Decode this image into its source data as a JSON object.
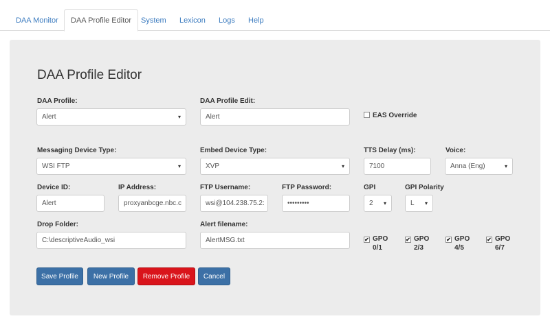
{
  "tabs": [
    "DAA Monitor",
    "DAA Profile Editor",
    "System",
    "Lexicon",
    "Logs",
    "Help"
  ],
  "active_tab": "DAA Profile Editor",
  "page_title": "DAA Profile Editor",
  "form": {
    "daa_profile": {
      "label": "DAA Profile:",
      "value": "Alert"
    },
    "daa_profile_edit": {
      "label": "DAA Profile Edit:",
      "value": "Alert"
    },
    "eas_override": {
      "label": "EAS Override",
      "checked": false
    },
    "messaging_device_type": {
      "label": "Messaging Device Type:",
      "value": "WSI FTP"
    },
    "embed_device_type": {
      "label": "Embed Device Type:",
      "value": "XVP"
    },
    "tts_delay": {
      "label": "TTS Delay (ms):",
      "value": "7100"
    },
    "voice": {
      "label": "Voice:",
      "value": "Anna (Eng)"
    },
    "device_id": {
      "label": "Device ID:",
      "value": "Alert"
    },
    "ip_address": {
      "label": "IP Address:",
      "value": "proxyanbcge.nbc.c"
    },
    "ftp_username": {
      "label": "FTP Username:",
      "value": "wsi@104.238.75.2:"
    },
    "ftp_password": {
      "label": "FTP Password:",
      "value": "•••••••••"
    },
    "gpi": {
      "label": "GPI",
      "value": "2"
    },
    "gpi_polarity": {
      "label": "GPI Polarity",
      "value": "L"
    },
    "drop_folder": {
      "label": "Drop Folder:",
      "value": "C:\\descriptiveAudio_wsi"
    },
    "alert_filename": {
      "label": "Alert filename:",
      "value": "AlertMSG.txt"
    },
    "gpo": [
      {
        "top": "GPO",
        "bottom": "0/1",
        "checked": true
      },
      {
        "top": "GPO",
        "bottom": "2/3",
        "checked": true
      },
      {
        "top": "GPO",
        "bottom": "4/5",
        "checked": true
      },
      {
        "top": "GPO",
        "bottom": "6/7",
        "checked": true
      }
    ]
  },
  "buttons": {
    "save": "Save Profile",
    "new": "New Profile",
    "remove": "Remove Profile",
    "cancel": "Cancel"
  },
  "caret": "▾",
  "check_mark": "✔"
}
